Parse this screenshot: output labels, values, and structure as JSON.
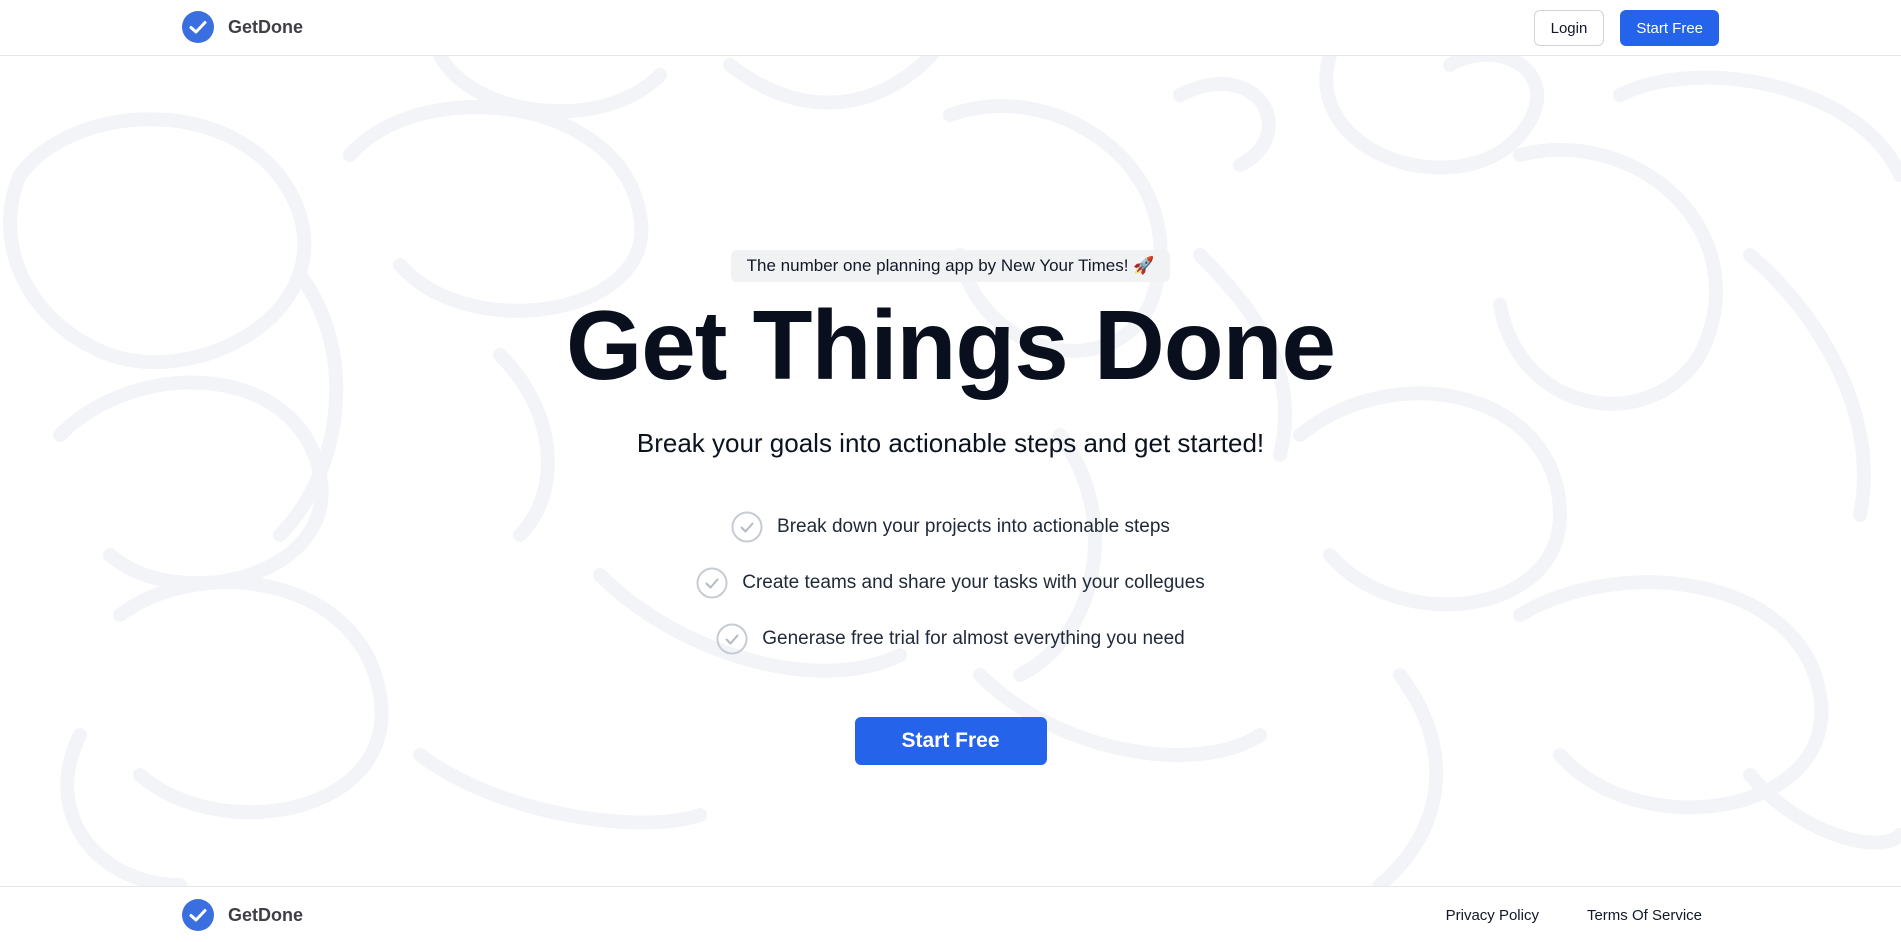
{
  "header": {
    "brand_name": "GetDone",
    "logo_icon": "check-circle-icon",
    "login_label": "Login",
    "start_label": "Start Free"
  },
  "hero": {
    "badge_text": "The number one planning app by New Your Times! 🚀",
    "title": "Get Things Done",
    "subtitle": "Break your goals into actionable steps and get started!",
    "features": [
      "Break down your projects into actionable steps",
      "Create teams and share your tasks with your collegues",
      "Generase free trial for almost everything you need"
    ],
    "cta_label": "Start Free"
  },
  "footer": {
    "brand_name": "GetDone",
    "links": [
      "Privacy Policy",
      "Terms Of Service"
    ]
  },
  "colors": {
    "accent": "#2563eb",
    "text": "#0a0f1e",
    "border": "#e5e7eb",
    "badge_bg": "#f1f2f4",
    "doodle": "#f2f4f7"
  }
}
